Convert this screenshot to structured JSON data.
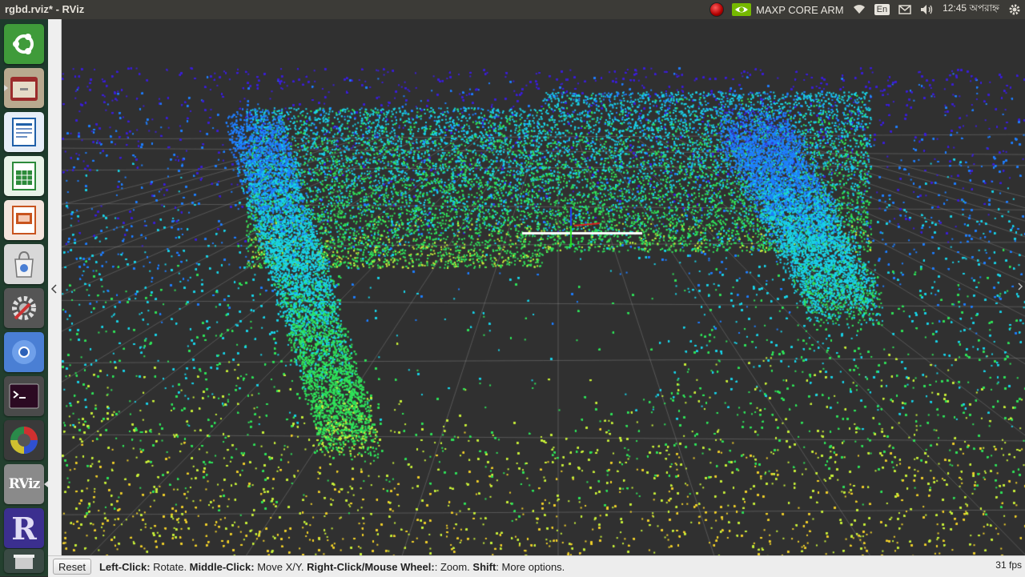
{
  "window": {
    "title": "rgbd.rviz* - RViz"
  },
  "top_panel": {
    "nvidia_label": "MAXP CORE ARM",
    "language": "En",
    "clock": "12:45 অপরাহ্ন",
    "icons": [
      "record-icon",
      "nvidia-icon",
      "wifi-icon",
      "language-icon",
      "mail-icon",
      "volume-icon",
      "gear-icon"
    ]
  },
  "launcher": {
    "items": [
      {
        "name": "ubuntu-dash-icon",
        "color": "#3f9b3a"
      },
      {
        "name": "files-icon",
        "color": "#b8a98f"
      },
      {
        "name": "writer-icon",
        "color": "#1f5fa8"
      },
      {
        "name": "calc-icon",
        "color": "#2c8a3a"
      },
      {
        "name": "impress-icon",
        "color": "#c8541e"
      },
      {
        "name": "software-center-icon",
        "color": "#d8d8d8"
      },
      {
        "name": "system-settings-icon",
        "color": "#555555"
      },
      {
        "name": "chromium-icon",
        "color": "#4a7fd4"
      },
      {
        "name": "terminal-icon",
        "color": "#2f2f2f"
      },
      {
        "name": "color-wheel-icon",
        "color": "#3a3a3a"
      },
      {
        "name": "rviz-icon",
        "color": "#8a8a8a"
      },
      {
        "name": "r-app-icon",
        "color": "#3b2f8f"
      },
      {
        "name": "trash-icon",
        "color": "#3a4a44"
      }
    ],
    "rviz_label": "RViz",
    "r_label": "R"
  },
  "viewport": {
    "view": "rgbd-point-cloud-3d",
    "colors": [
      "#3c1fd6",
      "#1f7fff",
      "#19d3e8",
      "#2fe35a",
      "#c8f03a",
      "#f0d02a",
      "#e8501e"
    ]
  },
  "status_bar": {
    "reset_label": "Reset",
    "hint_left_click": "Left-Click:",
    "hint_left_click_action": " Rotate. ",
    "hint_middle_click": "Middle-Click:",
    "hint_middle_click_action": " Move X/Y. ",
    "hint_right_click": "Right-Click/Mouse Wheel:",
    "hint_right_click_action": ": Zoom. ",
    "hint_shift": "Shift",
    "hint_shift_action": ": More options.",
    "fps": "31 fps"
  }
}
